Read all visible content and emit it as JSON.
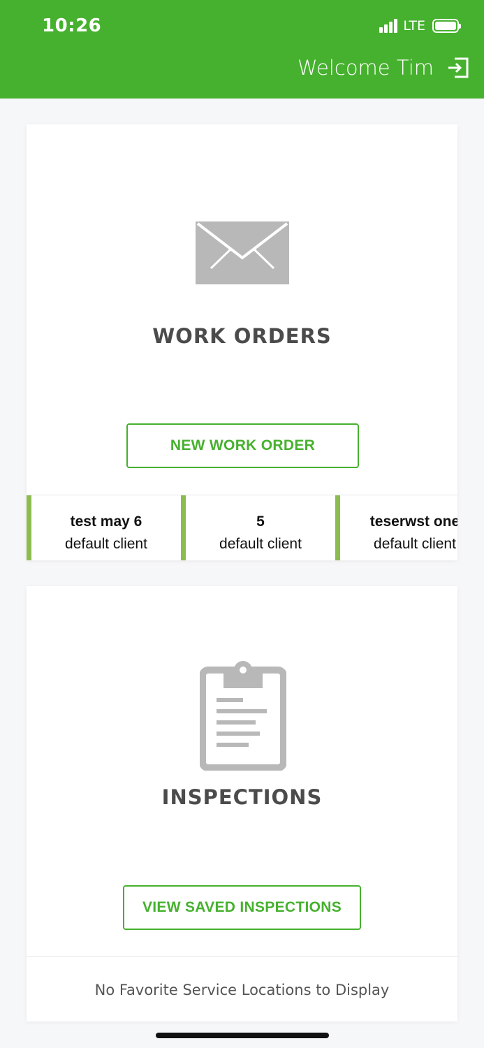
{
  "status_bar": {
    "time": "10:26",
    "network": "LTE"
  },
  "header": {
    "welcome_text": "Welcome Tim",
    "logout_icon": "logout-icon",
    "background_color": "#46b12e"
  },
  "work_orders": {
    "icon": "envelope-icon",
    "title": "WORK ORDERS",
    "new_button_label": "NEW WORK ORDER",
    "recent": [
      {
        "title": "test may 6",
        "client": "default client"
      },
      {
        "title": "5",
        "client": "default client"
      },
      {
        "title": "teserwst one",
        "client": "default client"
      }
    ]
  },
  "inspections": {
    "icon": "clipboard-icon",
    "title": "INSPECTIONS",
    "view_button_label": "VIEW SAVED INSPECTIONS",
    "favorites_empty_text": "No Favorite Service Locations to Display"
  },
  "colors": {
    "accent": "#46b12e",
    "tile_bar": "#8cbb4f",
    "icon_gray": "#b8b8b8"
  }
}
